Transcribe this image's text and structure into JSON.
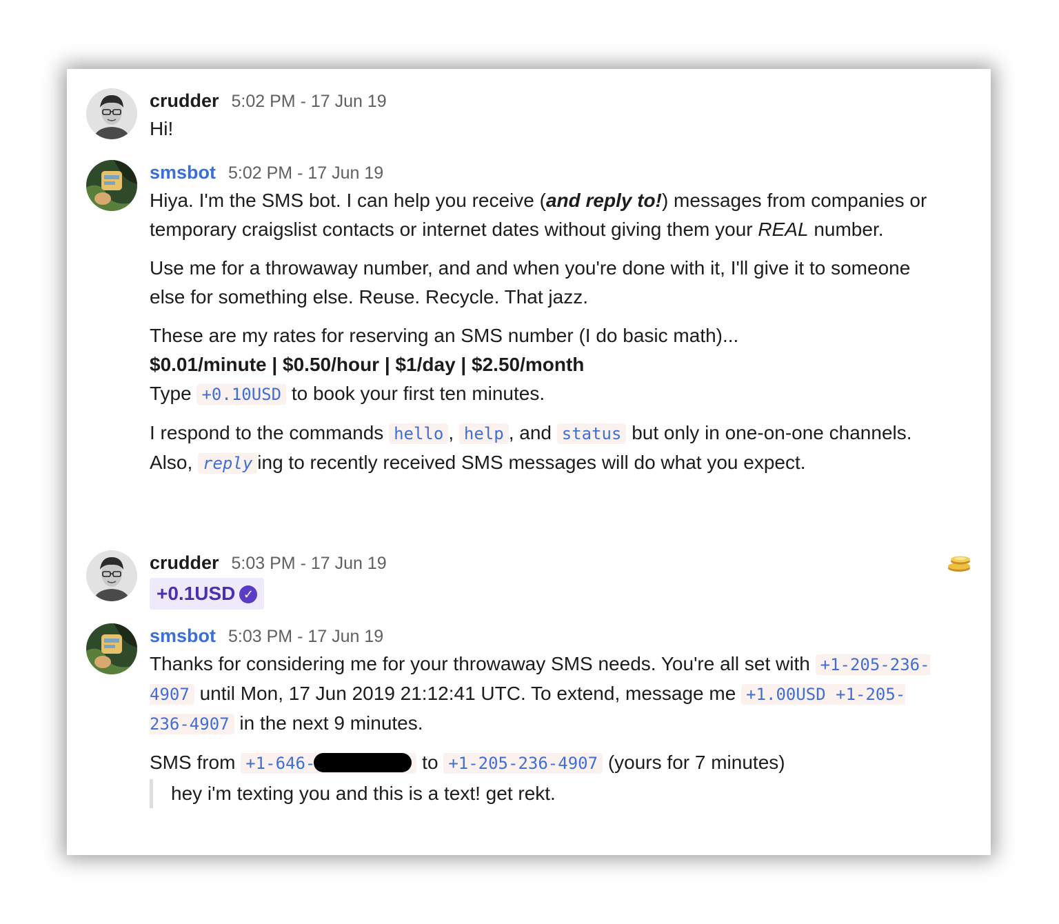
{
  "messages": [
    {
      "author": "crudder",
      "time": "5:02 PM - 17 Jun 19",
      "text": "Hi!"
    },
    {
      "author": "smsbot",
      "time": "5:02 PM - 17 Jun 19",
      "p1_a": "Hiya. I'm the SMS bot. I can help you receive (",
      "p1_b": "and reply to!",
      "p1_c": ") messages from companies or temporary craigslist contacts or internet dates without giving them your ",
      "p1_d": "REAL",
      "p1_e": " number.",
      "p2": "Use me for a  throwaway number, and and when you're done with it, I'll give it to someone else for something else. Reuse. Recycle. That jazz.",
      "p3": "These are my rates for reserving an SMS number (I do basic math)...",
      "rates": "$0.01/minute | $0.50/hour | $1/day | $2.50/month",
      "type_a": "Type ",
      "type_code": "+0.10USD",
      "type_b": " to book your first ten minutes.",
      "cmd_a": "I respond to the commands ",
      "cmd_hello": "hello",
      "cmd_sep1": ", ",
      "cmd_help": "help",
      "cmd_sep2": ", and ",
      "cmd_status": "status",
      "cmd_b": " but only in one-on-one channels.",
      "also_a": "Also, ",
      "also_code": "reply",
      "also_b": "ing to recently received SMS messages will do what you expect."
    },
    {
      "author": "crudder",
      "time": "5:03 PM - 17 Jun 19",
      "token": "+0.1USD",
      "check": "✓"
    },
    {
      "author": "smsbot",
      "time": "5:03 PM - 17 Jun 19",
      "t1_a": "Thanks for considering me for your throwaway SMS needs. You're all set with ",
      "t1_code": "+1-205-236-4907",
      "t1_b": " until Mon, 17 Jun 2019 21:12:41 UTC. To extend, message me ",
      "t1_code2": "+1.00USD +1-205-236-4907",
      "t1_c": " in the next 9 minutes.",
      "sms_a": "SMS from ",
      "sms_from": "+1-646-",
      "sms_to_word": " to ",
      "sms_to": "+1-205-236-4907",
      "sms_b": " (yours for 7 minutes)",
      "quote": "hey i'm texting you and this is a text! get rekt."
    }
  ],
  "reaction_icon": "coins-icon",
  "colors": {
    "bot_name": "#3a6fd8",
    "code_text": "#3f6fd6",
    "code_bg": "#fbf1ef",
    "token_bg": "#eee9fb",
    "token_text": "#4b2fb0"
  }
}
